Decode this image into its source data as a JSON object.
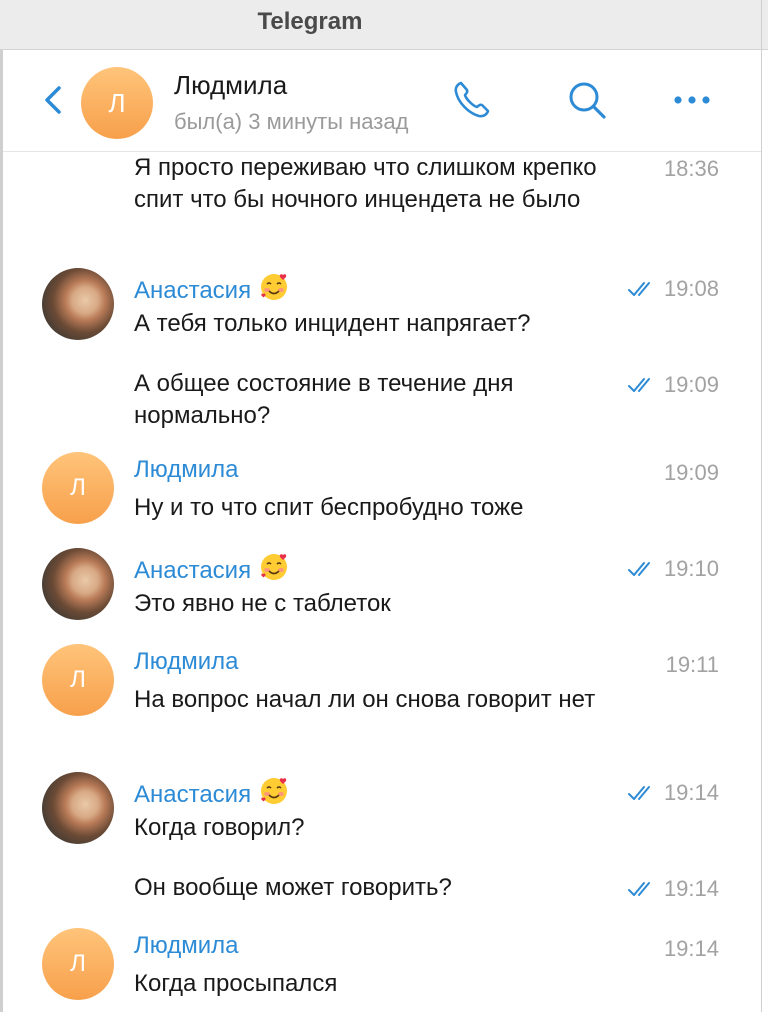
{
  "window": {
    "title": "Telegram"
  },
  "header": {
    "name": "Людмила",
    "status": "был(а) 3 минуты назад",
    "avatar_letter": "Л",
    "icons": [
      "back-icon",
      "phone-icon",
      "search-icon",
      "more-icon"
    ]
  },
  "colors": {
    "accent": "#2d8bd6",
    "avatar_orange": "#f7a04b",
    "time_gray": "#a2a2a2"
  },
  "messages": [
    {
      "sender": "",
      "text": "Я просто переживаю что слишком крепко спит что бы ночного инцендета не было",
      "time": "18:36",
      "read": false
    },
    {
      "sender": "Анастасия",
      "emoji": "smiling-face-with-hearts",
      "text": "А тебя только инцидент напрягает?",
      "time": "19:08",
      "read": true
    },
    {
      "sender": "",
      "text": "А общее состояние в течение дня нормально?",
      "time": "19:09",
      "read": true
    },
    {
      "sender": "Людмила",
      "avatar_letter": "Л",
      "text": "Ну и то что спит беспробудно тоже",
      "time": "19:09",
      "read": false
    },
    {
      "sender": "Анастасия",
      "emoji": "smiling-face-with-hearts",
      "text": "Это явно не с таблеток",
      "time": "19:10",
      "read": true
    },
    {
      "sender": "Людмила",
      "avatar_letter": "Л",
      "text": "На вопрос начал ли он снова говорит нет",
      "time": "19:11",
      "read": false
    },
    {
      "sender": "Анастасия",
      "emoji": "smiling-face-with-hearts",
      "text": "Когда говорил?",
      "time": "19:14",
      "read": true
    },
    {
      "sender": "",
      "text": "Он вообще может говорить?",
      "time": "19:14",
      "read": true
    },
    {
      "sender": "Людмила",
      "avatar_letter": "Л",
      "text": "Когда просыпался",
      "time": "19:14",
      "read": false
    }
  ]
}
